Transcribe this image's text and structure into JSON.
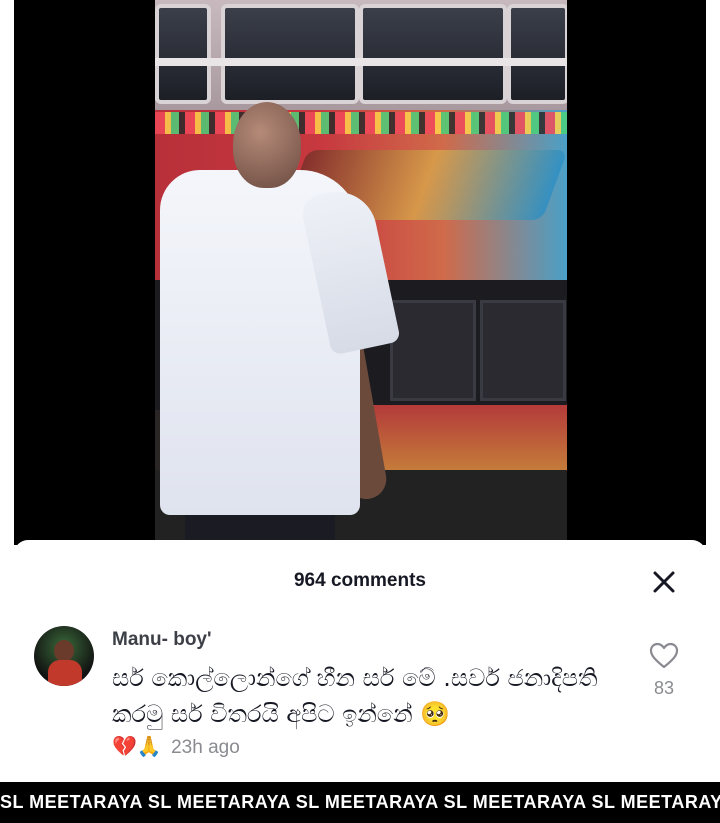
{
  "comments_panel": {
    "title": "964 comments",
    "close_icon": "close-icon"
  },
  "comment": {
    "username": "Manu- boy'",
    "text": "සර් කොල්ලොන්ගේ හීන සර් මේ .සර්ව ජනාදිපති කරමු සර් විතරයි අපිට ඉන්නේ 🥺",
    "reactions": "💔🙏",
    "time": "23h ago",
    "like_count": "83",
    "like_icon": "heart-outline-icon"
  },
  "watermark": {
    "text": "SL MEETARAYA  SL MEETARAYA  SL MEETARAYA  SL MEETARAYA  SL MEETARAYA"
  }
}
